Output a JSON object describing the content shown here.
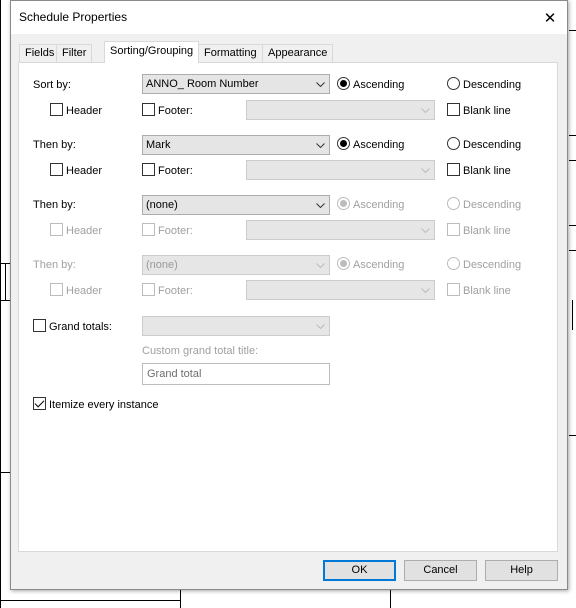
{
  "dialog": {
    "title": "Schedule Properties",
    "close_symbol": "✕"
  },
  "tabs": [
    "Fields",
    "Filter",
    "Sorting/Grouping",
    "Formatting",
    "Appearance"
  ],
  "active_tab": "Sorting/Grouping",
  "labels": {
    "sort_by": "Sort by:",
    "then_by": "Then by:",
    "header": "Header",
    "footer": "Footer:",
    "blank_line": "Blank line",
    "ascending": "Ascending",
    "descending": "Descending",
    "grand_totals": "Grand totals:",
    "custom_grand_total_title": "Custom grand total title:",
    "itemize": "Itemize every instance"
  },
  "sort_rows": [
    {
      "field": "ANNO_ Room Number",
      "order": "ascending",
      "header": false,
      "footer": false,
      "footer_option": "",
      "blank_line": false,
      "enabled": true
    },
    {
      "field": "Mark",
      "order": "ascending",
      "header": false,
      "footer": false,
      "footer_option": "",
      "blank_line": false,
      "enabled": true
    },
    {
      "field": "(none)",
      "order": "ascending",
      "header": false,
      "footer": false,
      "footer_option": "",
      "blank_line": false,
      "enabled": true
    },
    {
      "field": "(none)",
      "order": "ascending",
      "header": false,
      "footer": false,
      "footer_option": "",
      "blank_line": false,
      "enabled": false
    }
  ],
  "grand_totals": {
    "checked": false,
    "option": ""
  },
  "grand_total_title": "Grand total",
  "itemize_every_instance": true,
  "buttons": {
    "ok": "OK",
    "cancel": "Cancel",
    "help": "Help"
  },
  "icons": {
    "close": "close-icon",
    "dropdown": "chevron-down-icon"
  }
}
